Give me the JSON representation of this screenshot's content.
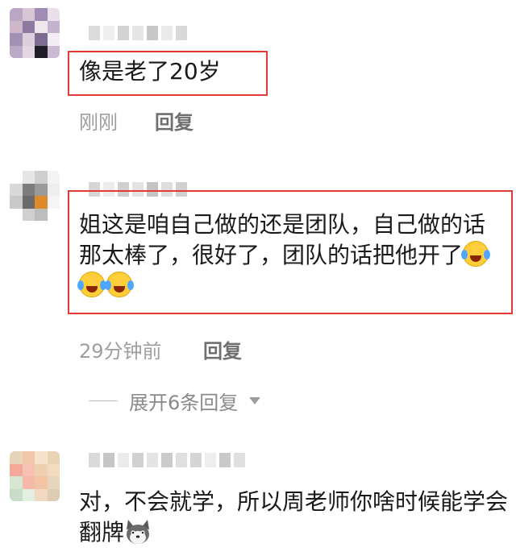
{
  "comments": [
    {
      "text": "像是老了20岁",
      "time": "刚刚",
      "reply_label": "回复",
      "avatar_colors": [
        "#b9a7c3",
        "#d8c6d6",
        "#9f8bb4",
        "#e9e0ea",
        "#cdb7c9",
        "#8d7aa1",
        "#efe7ee",
        "#c4b2cf",
        "#a391b5",
        "#dcd0df",
        "#7e6d90",
        "#f2ecf3",
        "#bba9c6",
        "#e1d6e2",
        "#1e1e28",
        "#cabbd3"
      ]
    },
    {
      "text": "姐这是咱自己做的还是团队，自己做的话那太棒了，很好了，团队的话把他开了",
      "emoji_count": 3,
      "emoji_name": "laughing-crying-emoji",
      "time": "29分钟前",
      "reply_label": "回复",
      "expand_label": "展开6条回复",
      "avatar_colors": [
        "#ffffff",
        "#e6e6e6",
        "#cfcfcf",
        "#f4f4f4",
        "#d9d9d9",
        "#7d7d7d",
        "#9a9a9a",
        "#eeeeee",
        "#c9c9c9",
        "#6a6a6a",
        "#e08a2e",
        "#f6f6f6",
        "#ffffff",
        "#d0d0d0",
        "#bdbdbd",
        "#ffffff"
      ]
    },
    {
      "text": "对，不会就学，所以周老师你啥时候能学会翻牌",
      "emoji_name": "husky-emoji",
      "avatar_colors": [
        "#e8d4b8",
        "#f0c8a8",
        "#f6e3c9",
        "#ead2b4",
        "#f3a99a",
        "#f7c1b3",
        "#eecfae",
        "#f2dcc0",
        "#d6e6d1",
        "#f6b8a8",
        "#f2c4a4",
        "#e7d5bd",
        "#c9dcc7",
        "#e3efe0",
        "#f0d9c0",
        "#ddcbb3"
      ]
    }
  ]
}
